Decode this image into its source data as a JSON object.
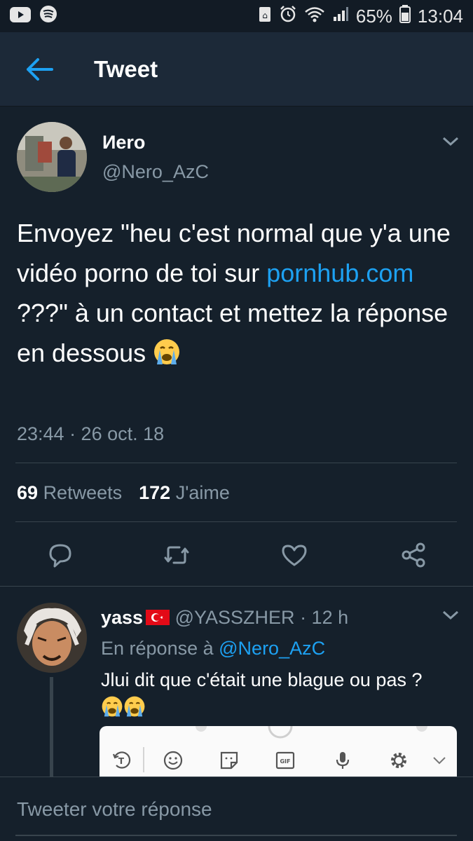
{
  "status_bar": {
    "battery_percent": "65%",
    "time": "13:04",
    "left_icons": [
      "youtube-icon",
      "spotify-icon"
    ],
    "right_icons": [
      "data-saver-icon",
      "alarm-icon",
      "wifi-icon",
      "signal-icon",
      "battery-icon"
    ]
  },
  "app_bar": {
    "title": "Tweet"
  },
  "tweet": {
    "author_name": "Иero",
    "author_handle": "@Nero_AzC",
    "text_part1": "Envoyez \"heu c'est normal que y'a une vidéo porno de toi sur ",
    "link_text": "pornhub.com",
    "text_part2": " ???\" à un contact et mettez la réponse en dessous ",
    "emoji": "loudly-crying-face",
    "timestamp": "23:44 · 26 oct. 18",
    "retweet_count": "69",
    "retweet_label": "Retweets",
    "like_count": "172",
    "like_label": "J'aime"
  },
  "reply": {
    "author_name": "yass",
    "flag": "turkey-flag",
    "author_handle": "@YASSZHER",
    "time_ago": "· 12 h",
    "replying_to_label": "En réponse à",
    "replying_to_handle": "@Nero_AzC",
    "text": "Jlui dit que c'était une blague ou pas ?",
    "emoji_count": 2
  },
  "composer": {
    "placeholder": "Tweeter votre réponse"
  },
  "colors": {
    "background": "#15202b",
    "app_bar": "#1c2938",
    "accent": "#1da1f2",
    "secondary_text": "#8899a6",
    "divider": "#38444d"
  }
}
